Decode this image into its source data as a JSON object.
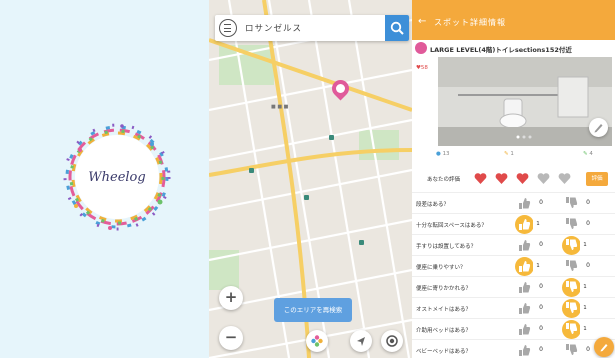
{
  "splash": {
    "logo_text": "Wheelog"
  },
  "map": {
    "search_text": "ロサンゼルス",
    "search_icon": "search-icon",
    "zoom_in_label": "+",
    "zoom_out_label": "−",
    "spot_search_label": "このエリアを再検索",
    "colors": {
      "road": "#ffffff",
      "major_road": "#f6cf65",
      "park": "#cfe6c4",
      "water": "#aad3df",
      "accent": "#3d8fd8",
      "pin": "#e05a9a"
    }
  },
  "detail": {
    "header_title": "スポット詳細情報",
    "spot_name": "LARGE LEVEL(4階)トイレsections152付近",
    "fav_label": "♥58",
    "stats": [
      {
        "icon": "comment-icon",
        "label": "13"
      },
      {
        "icon": "edit-icon",
        "label": "1"
      },
      {
        "icon": "walk-icon",
        "label": "4"
      }
    ],
    "rating_label": "あなたの評価",
    "rating_value": 3,
    "rating_max": 5,
    "rate_button": "評価",
    "questions": [
      {
        "label": "段差はある？",
        "yes": "0",
        "no": "0"
      },
      {
        "label": "十分な転回スペースはある？",
        "yes": "1",
        "no": "0"
      },
      {
        "label": "手すりは設置してある？",
        "yes": "0",
        "no": "1"
      },
      {
        "label": "便座に乗りやすい？",
        "yes": "1",
        "no": "0"
      },
      {
        "label": "便座に寄りかかれる？",
        "yes": "0",
        "no": "1"
      },
      {
        "label": "オストメイトはある？",
        "yes": "0",
        "no": "1"
      },
      {
        "label": "介助用ベッドはある？",
        "yes": "0",
        "no": "1"
      },
      {
        "label": "ベビーベッドはある？",
        "yes": "0",
        "no": "0"
      }
    ],
    "colors": {
      "header": "#f4a93c",
      "heart_on": "#e04a4a",
      "heart_off": "#b8b8b8"
    }
  }
}
